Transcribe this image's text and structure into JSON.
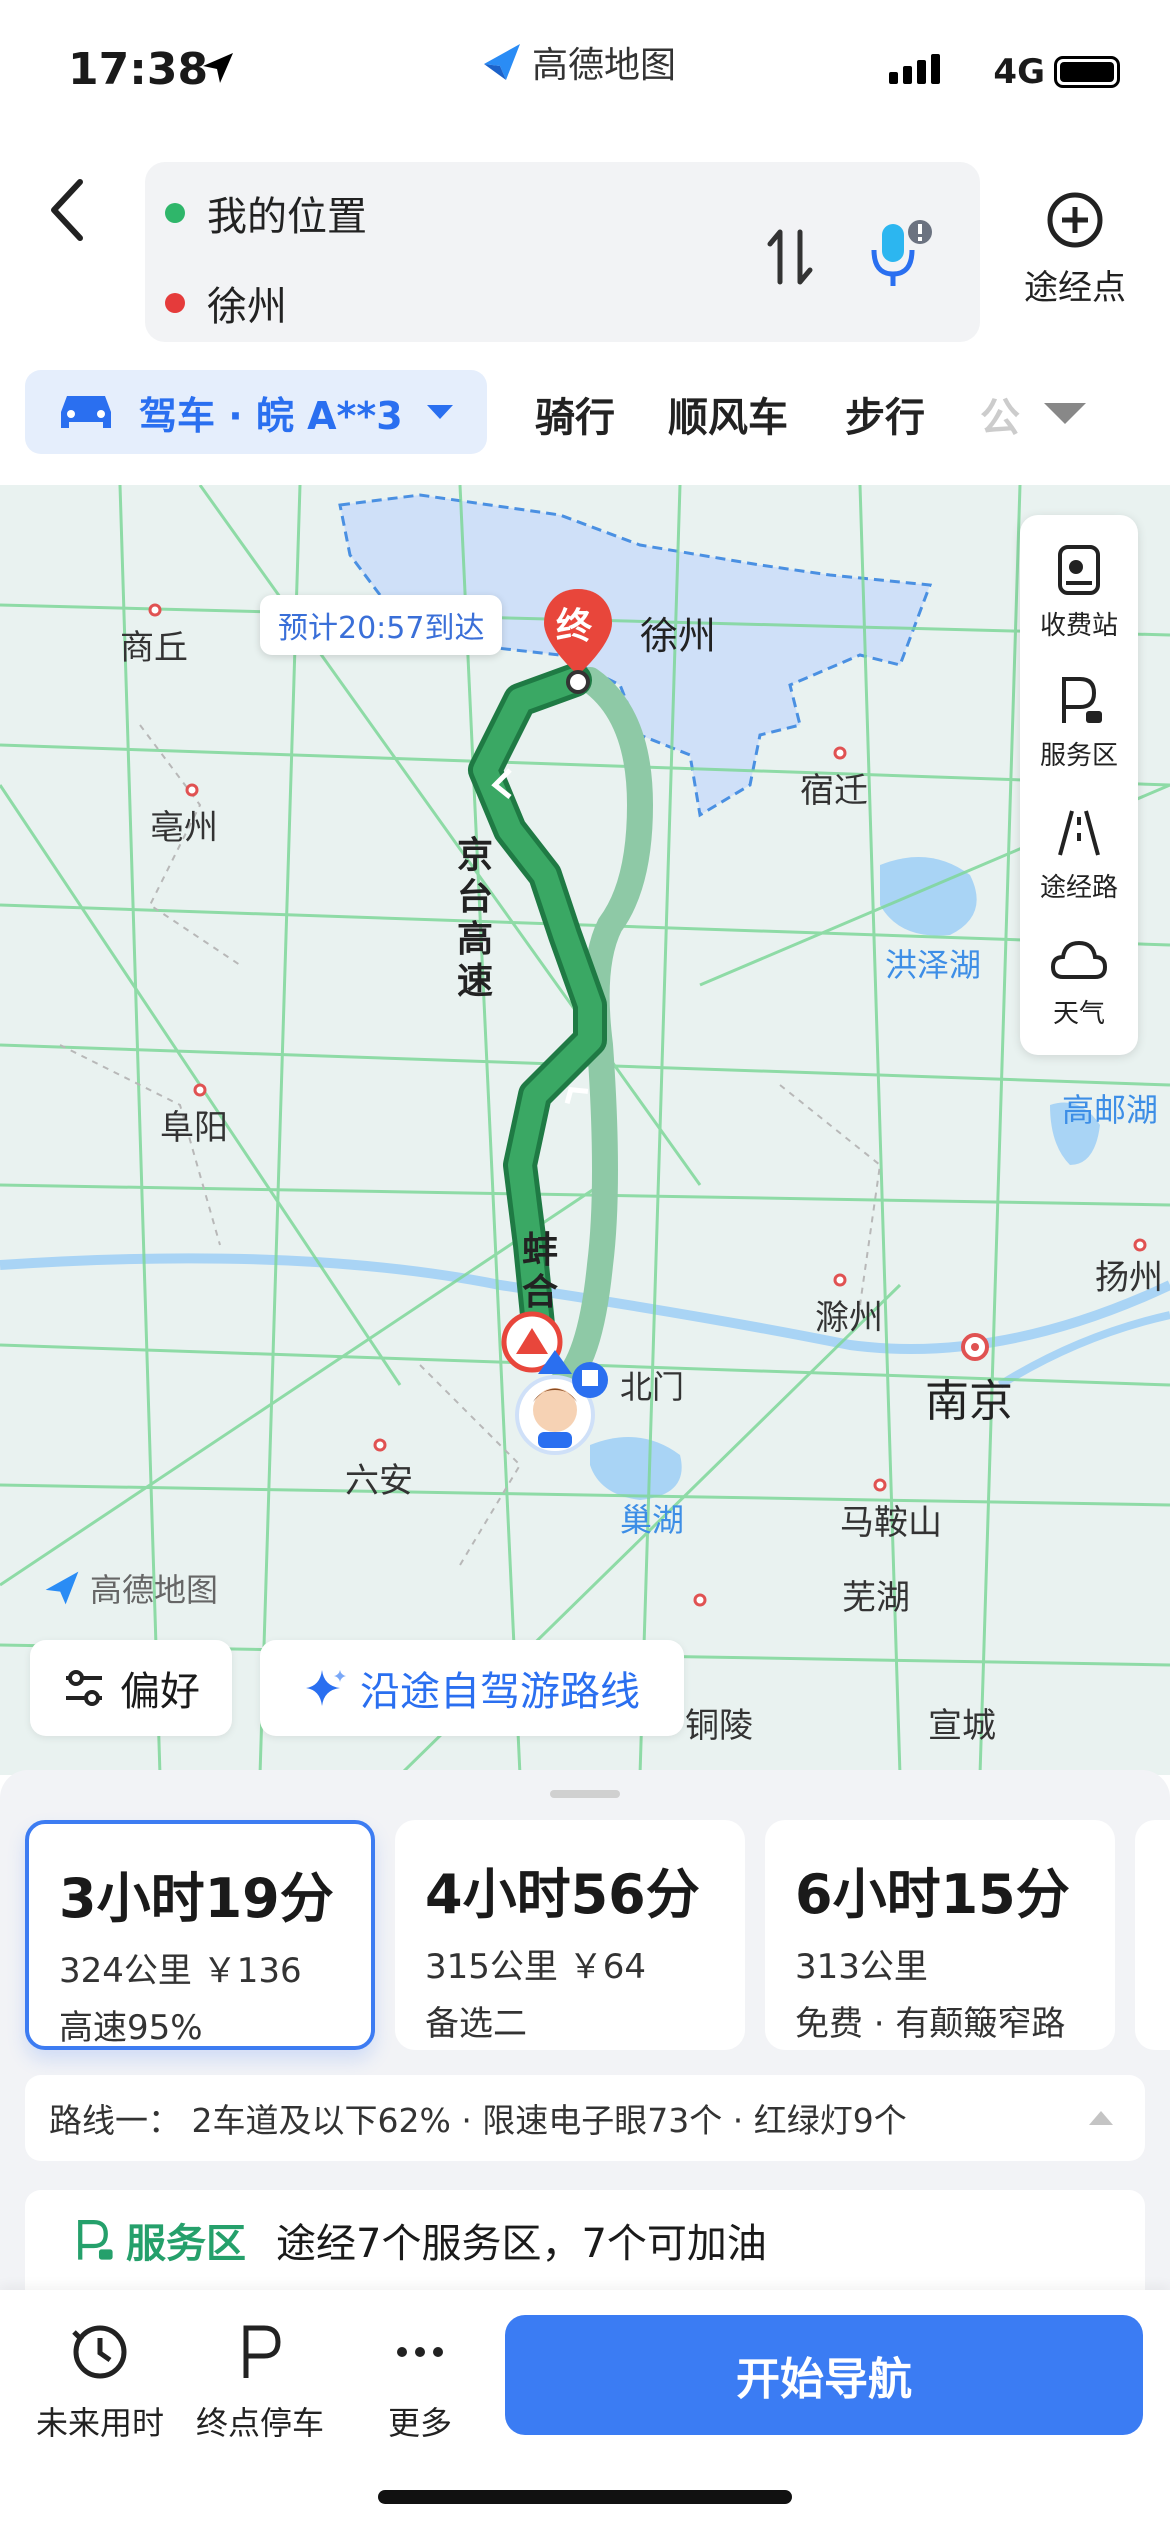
{
  "status": {
    "time": "17:38",
    "app": "高德地图",
    "network": "4G"
  },
  "search": {
    "from": "我的位置",
    "to": "徐州",
    "waypoint_label": "途经点"
  },
  "modes": {
    "drive": "驾车 · 皖 A**3",
    "tabs": [
      "骑行",
      "顺风车",
      "步行",
      "公"
    ]
  },
  "map": {
    "eta": "预计20:57到达",
    "end_marker": "终",
    "road_name": [
      "京",
      "台",
      "高",
      "速"
    ],
    "road_name2": [
      "蚌",
      "合"
    ],
    "cities": [
      "商丘",
      "徐州",
      "亳州",
      "宿迁",
      "洪泽湖",
      "阜阳",
      "高邮湖",
      "扬州",
      "滁州",
      "北门",
      "南京",
      "六安",
      "巢湖",
      "马鞍山",
      "芜湖",
      "铜陵",
      "宣城"
    ],
    "watermark": "高德地图",
    "side": [
      "收费站",
      "服务区",
      "途经路",
      "天气"
    ],
    "pref": "偏好",
    "tour": "沿途自驾游路线"
  },
  "routes": [
    {
      "duration": "3小时19分",
      "meta": "324公里 ￥136",
      "tag": "高速95%"
    },
    {
      "duration": "4小时56分",
      "meta": "315公里 ￥64",
      "tag": "备选二"
    },
    {
      "duration": "6小时15分",
      "meta": "313公里",
      "tag": "免费 · 有颠簸窄路"
    }
  ],
  "route_info": "路线一： 2车道及以下62% · 限速电子眼73个 · 红绿灯9个",
  "service": {
    "tag": "服务区",
    "text": "途经7个服务区，7个可加油"
  },
  "bottom": {
    "future": "未来用时",
    "parking": "终点停车",
    "more": "更多",
    "start": "开始导航"
  },
  "colors": {
    "accent": "#3b7cf3",
    "route_main": "#2f9a5a",
    "route_alt": "#8ec9a6",
    "province": "#cfe0f8"
  }
}
